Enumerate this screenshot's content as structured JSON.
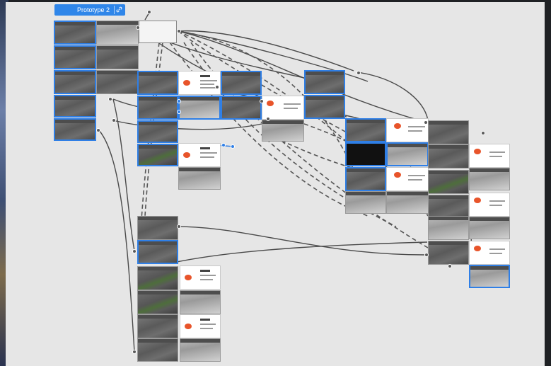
{
  "flow": {
    "name": "Prototype 2",
    "icon": "link-icon",
    "accent_color": "#2f86e9"
  },
  "canvas": {
    "background": "#e6e6e6",
    "frame_count": 62
  },
  "colors": {
    "selection": "#2f7fe6",
    "connector": "#4a4a4a",
    "overlay_accent": "#e8542a"
  }
}
